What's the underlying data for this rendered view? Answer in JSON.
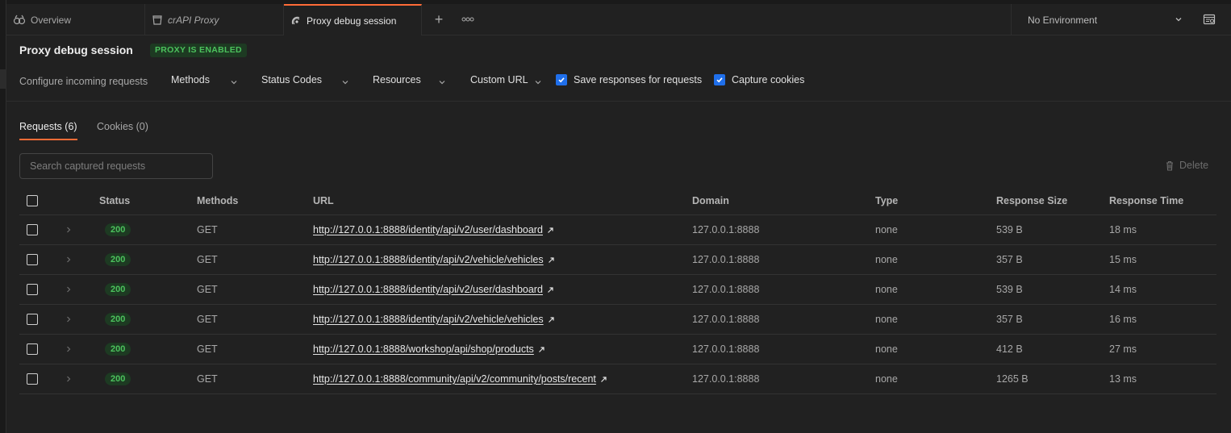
{
  "tabs": [
    {
      "label": "Overview",
      "icon": "overview-icon"
    },
    {
      "label": "crAPI Proxy",
      "icon": "proxy-file-icon"
    },
    {
      "label": "Proxy debug session",
      "icon": "proxy-session-icon"
    }
  ],
  "environment": {
    "label": "No Environment"
  },
  "header": {
    "title": "Proxy debug session",
    "badge": "PROXY IS ENABLED"
  },
  "config": {
    "label": "Configure incoming requests",
    "dropdowns": [
      "Methods",
      "Status Codes",
      "Resources",
      "Custom URL"
    ],
    "checkboxes": [
      {
        "label": "Save responses for requests",
        "checked": true
      },
      {
        "label": "Capture cookies",
        "checked": true
      }
    ]
  },
  "subtabs": {
    "requests": "Requests (6)",
    "cookies": "Cookies (0)"
  },
  "search": {
    "placeholder": "Search captured requests"
  },
  "delete_label": "Delete",
  "table": {
    "columns": [
      "Status",
      "Methods",
      "URL",
      "Domain",
      "Type",
      "Response Size",
      "Response Time"
    ],
    "rows": [
      {
        "status": "200",
        "method": "GET",
        "url": "http://127.0.0.1:8888/identity/api/v2/user/dashboard",
        "domain": "127.0.0.1:8888",
        "type": "none",
        "size": "539 B",
        "time": "18 ms"
      },
      {
        "status": "200",
        "method": "GET",
        "url": "http://127.0.0.1:8888/identity/api/v2/vehicle/vehicles",
        "domain": "127.0.0.1:8888",
        "type": "none",
        "size": "357 B",
        "time": "15 ms"
      },
      {
        "status": "200",
        "method": "GET",
        "url": "http://127.0.0.1:8888/identity/api/v2/user/dashboard",
        "domain": "127.0.0.1:8888",
        "type": "none",
        "size": "539 B",
        "time": "14 ms"
      },
      {
        "status": "200",
        "method": "GET",
        "url": "http://127.0.0.1:8888/identity/api/v2/vehicle/vehicles",
        "domain": "127.0.0.1:8888",
        "type": "none",
        "size": "357 B",
        "time": "16 ms"
      },
      {
        "status": "200",
        "method": "GET",
        "url": "http://127.0.0.1:8888/workshop/api/shop/products",
        "domain": "127.0.0.1:8888",
        "type": "none",
        "size": "412 B",
        "time": "27 ms"
      },
      {
        "status": "200",
        "method": "GET",
        "url": "http://127.0.0.1:8888/community/api/v2/community/posts/recent",
        "domain": "127.0.0.1:8888",
        "type": "none",
        "size": "1265 B",
        "time": "13 ms"
      }
    ]
  },
  "colors": {
    "accent": "#ff6c37",
    "success": "#4cc25d",
    "checkbox": "#1f6feb"
  }
}
